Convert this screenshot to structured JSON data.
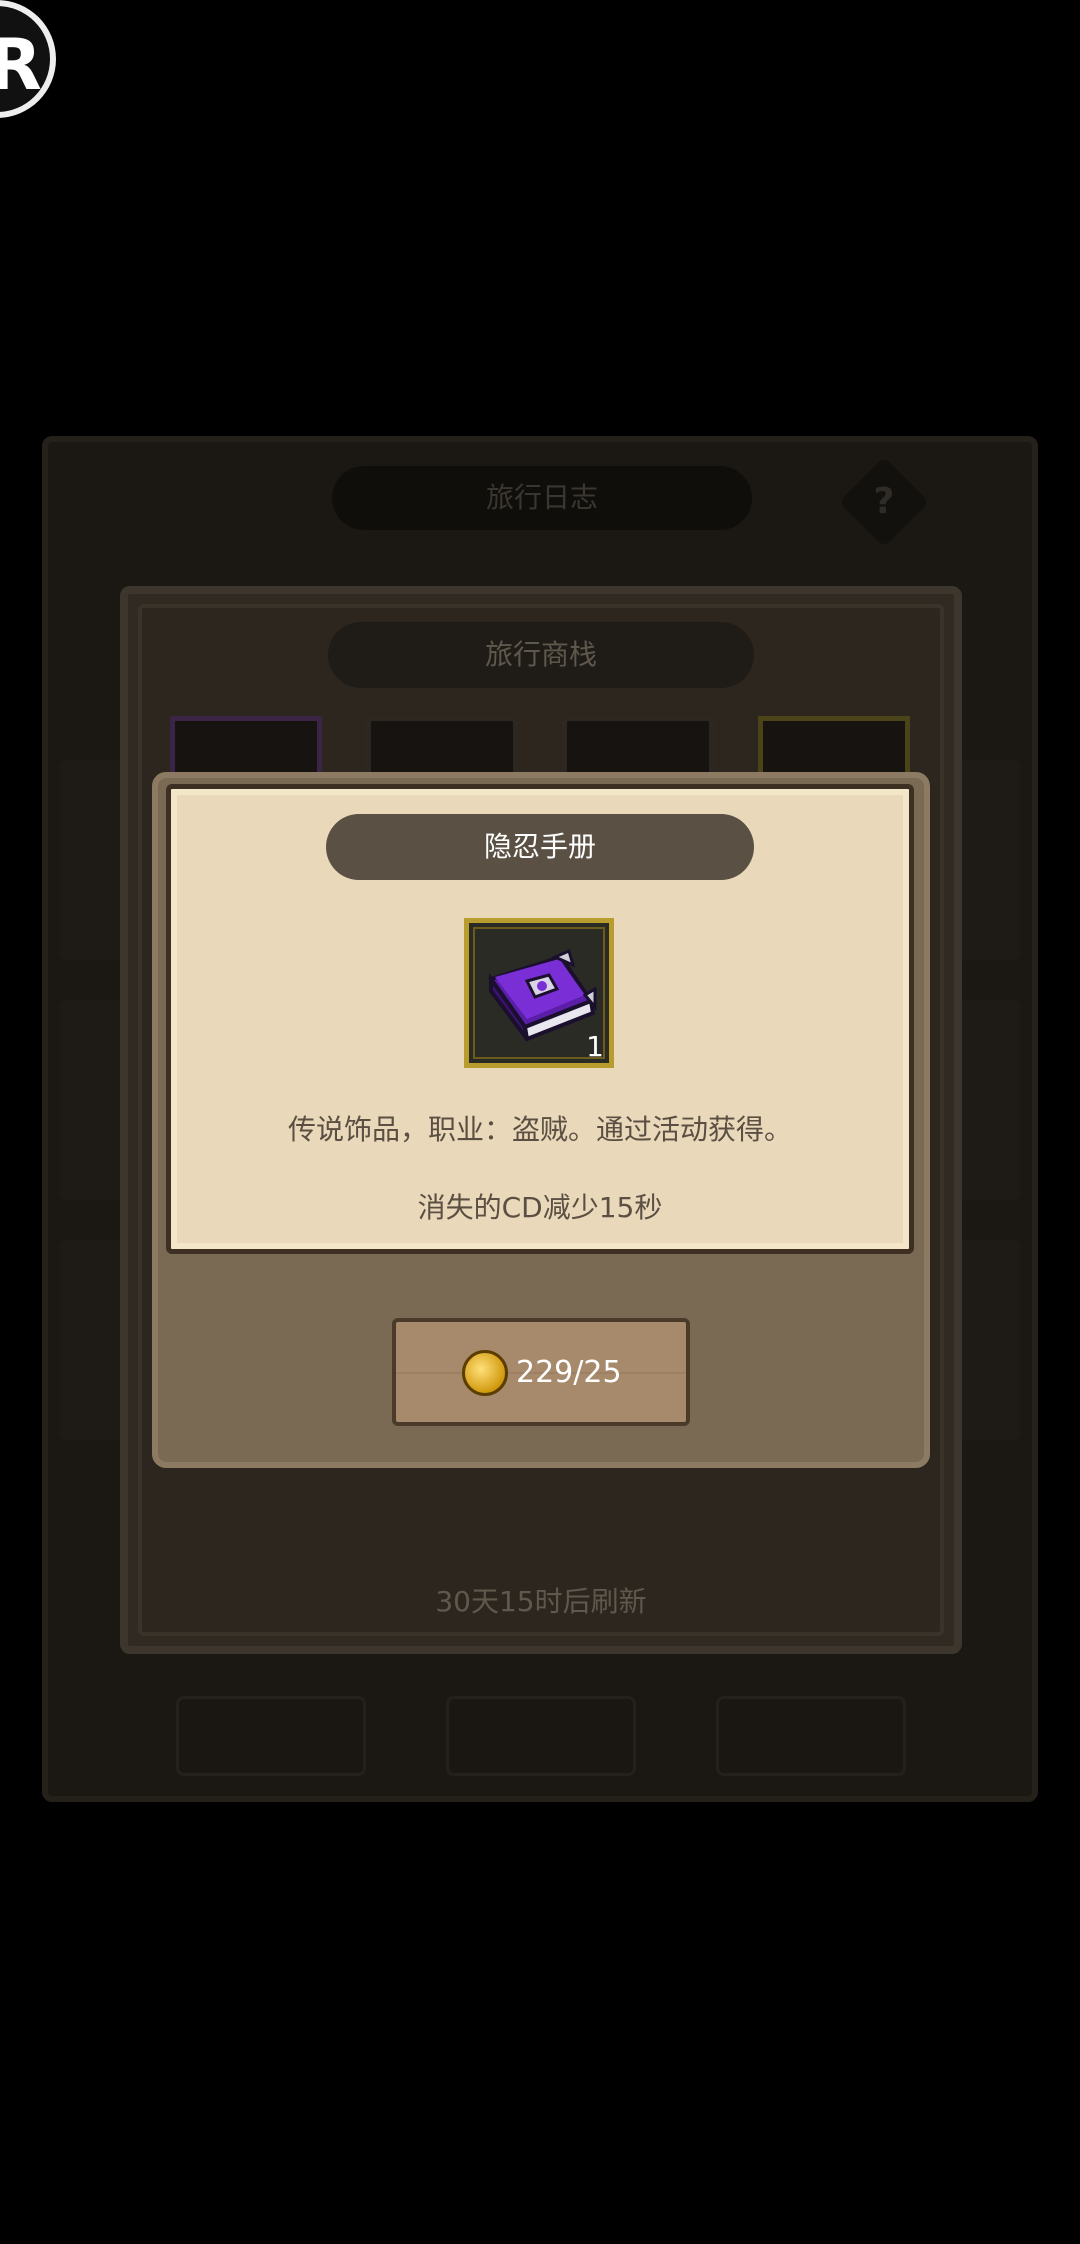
{
  "corner_badge": {
    "glyph": "R"
  },
  "background_panel": {
    "title": "旅行日志",
    "help_glyph": "?"
  },
  "shop": {
    "title": "旅行商栈",
    "refresh_text": "30天15时后刷新"
  },
  "modal": {
    "title": "隐忍手册",
    "item_icon": "purple-book-icon",
    "item_count": "1",
    "description": "传说饰品，职业：盗贼。通过活动获得。",
    "effect": "消失的CD减少15秒",
    "buy": {
      "currency_icon": "gold-coin-icon",
      "price": "229/25"
    }
  },
  "colors": {
    "modal_parchment": "#e9d8b9",
    "title_pill": "#5a5044",
    "frame_gold": "#b89c2e",
    "button_wood": "#a7896b",
    "book_purple": "#7a2fd6"
  }
}
